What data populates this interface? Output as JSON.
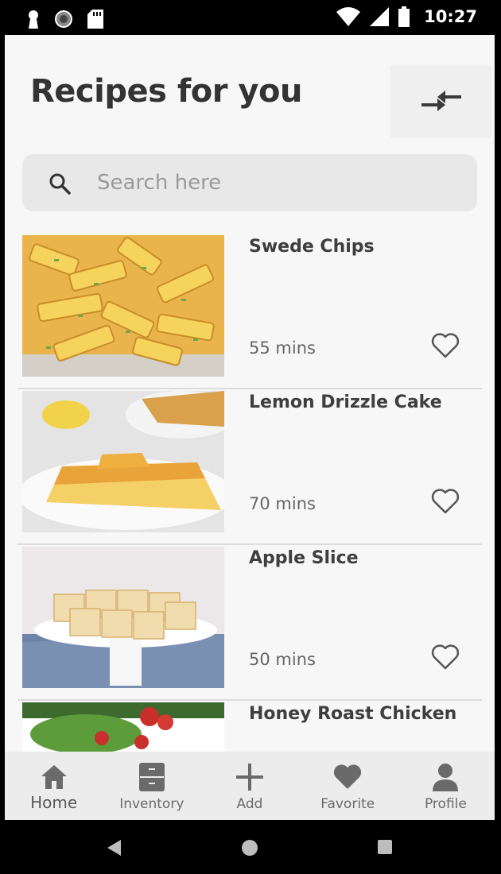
{
  "status_bar": {
    "time": "10:27",
    "left_icons": [
      "keyhole-icon",
      "sync-icon",
      "sd-card-icon"
    ],
    "right_icons": [
      "wifi-icon",
      "cell-signal-icon",
      "battery-icon"
    ]
  },
  "header": {
    "title": "Recipes for you",
    "collapse_icon": "compare-arrows-icon"
  },
  "search": {
    "placeholder": "Search here",
    "value": ""
  },
  "recipes": [
    {
      "title": "Swede Chips",
      "time": "55 mins",
      "image": "swede-chips-photo",
      "favorited": false
    },
    {
      "title": "Lemon Drizzle Cake",
      "time": "70 mins",
      "image": "lemon-cake-photo",
      "favorited": false
    },
    {
      "title": "Apple Slice",
      "time": "50 mins",
      "image": "apple-slice-photo",
      "favorited": false
    },
    {
      "title": "Honey Roast Chicken",
      "time": "",
      "image": "salad-photo",
      "favorited": false
    }
  ],
  "bottom_nav": [
    {
      "label": "Home",
      "icon": "home-icon",
      "active": true
    },
    {
      "label": "Inventory",
      "icon": "cabinet-icon",
      "active": false
    },
    {
      "label": "Add",
      "icon": "plus-icon",
      "active": false
    },
    {
      "label": "Favorite",
      "icon": "heart-icon",
      "active": false
    },
    {
      "label": "Profile",
      "icon": "person-icon",
      "active": false
    }
  ],
  "colors": {
    "background": "#f7f7f7",
    "search_bg": "#e8e8e8",
    "nav_bg": "#ececec",
    "title_text": "#333333",
    "icon_gray": "#6a6a6a"
  }
}
